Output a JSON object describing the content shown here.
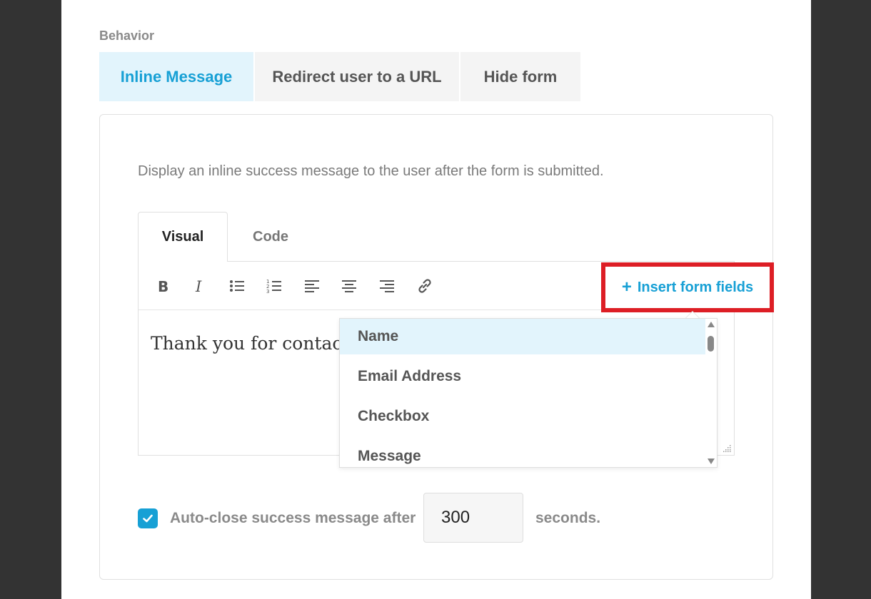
{
  "section": {
    "label": "Behavior"
  },
  "behavior_tabs": [
    {
      "label": "Inline Message",
      "active": true
    },
    {
      "label": "Redirect user to a URL",
      "active": false
    },
    {
      "label": "Hide form",
      "active": false
    }
  ],
  "inline": {
    "description": "Display an inline success message to the user after the form is submitted.",
    "editor_tabs": [
      {
        "label": "Visual",
        "active": true
      },
      {
        "label": "Code",
        "active": false
      }
    ],
    "toolbar": {
      "tools": [
        "bold-icon",
        "italic-icon",
        "bulleted-list-icon",
        "numbered-list-icon",
        "align-left-icon",
        "align-center-icon",
        "align-right-icon",
        "link-icon"
      ],
      "insert_button": {
        "icon": "plus",
        "label": "Insert form fields"
      }
    },
    "content": "Thank you for contact",
    "dropdown": {
      "items": [
        "Name",
        "Email Address",
        "Checkbox",
        "Message"
      ],
      "highlighted": "Name"
    }
  },
  "auto_close": {
    "checked": true,
    "label": "Auto-close success message after",
    "seconds_value": "300",
    "suffix": "seconds."
  },
  "colors": {
    "accent": "#17a0d5",
    "active_tab_bg": "#e2f4fc",
    "highlight_border": "#dd1e25",
    "background": "#333333"
  }
}
